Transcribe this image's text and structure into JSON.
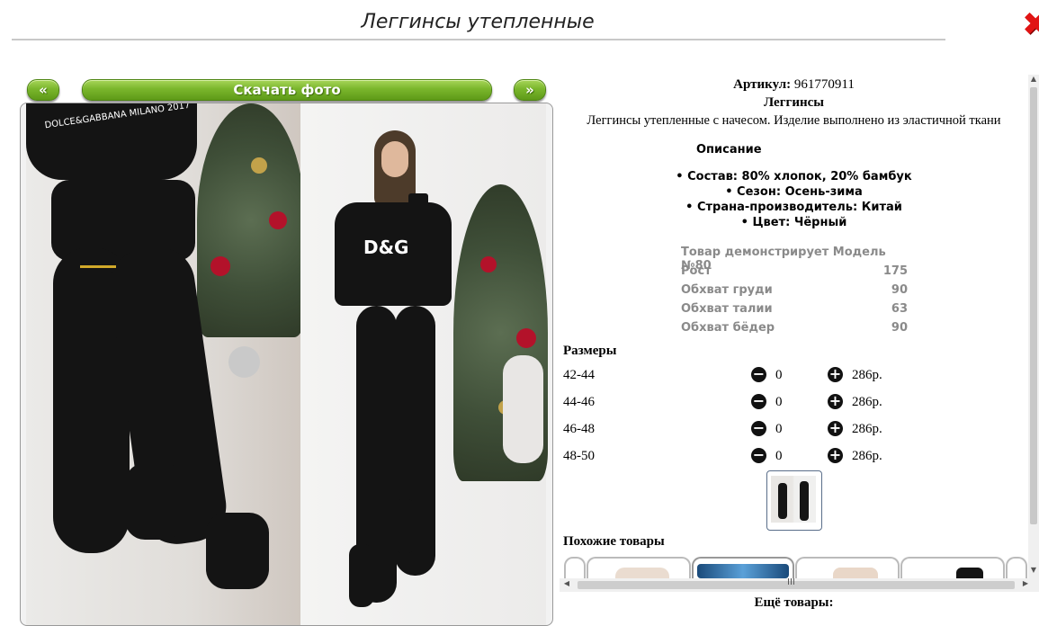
{
  "header": {
    "title": "Леггинсы утепленные",
    "close_glyph": "✖"
  },
  "gallery": {
    "prev_label": "«",
    "next_label": "»",
    "download_label": "Скачать фото",
    "button_color": "#7ab62c",
    "photo_text_left": "DOLCE&GABBANA MILANO 2017",
    "photo_text_right": "D&G"
  },
  "details": {
    "sku_label": "Артикул:",
    "sku_value": "961770911",
    "product_type": "Леггинсы",
    "short_description": "Леггинсы утепленные с начесом. Изделие выполнено из эластичной ткани",
    "description_heading": "Описание",
    "bullets": [
      "• Состав: 80% хлопок, 20% бамбук",
      "• Сезон: Осень-зима",
      "• Страна-производитель: Китай",
      "• Цвет: Чёрный"
    ],
    "model": {
      "title": "Товар демонстрирует Модель №80",
      "rows": [
        {
          "label": "Рост",
          "value": "175"
        },
        {
          "label": "Обхват груди",
          "value": "90"
        },
        {
          "label": "Обхват талии",
          "value": "63"
        },
        {
          "label": "Обхват бёдер",
          "value": "90"
        }
      ]
    },
    "sizes_heading": "Размеры",
    "sizes": [
      {
        "size": "42-44",
        "qty": "0",
        "price": "286р."
      },
      {
        "size": "44-46",
        "qty": "0",
        "price": "286р."
      },
      {
        "size": "46-48",
        "qty": "0",
        "price": "286р."
      },
      {
        "size": "48-50",
        "qty": "0",
        "price": "286р."
      }
    ],
    "minus_glyph": "−",
    "plus_glyph": "+",
    "similar_heading": "Похожие товары"
  },
  "footer": {
    "more_label": "Ещё товары:"
  },
  "scroll": {
    "up": "▲",
    "down": "▼",
    "left": "◀",
    "right": "▶",
    "grip": "III"
  }
}
